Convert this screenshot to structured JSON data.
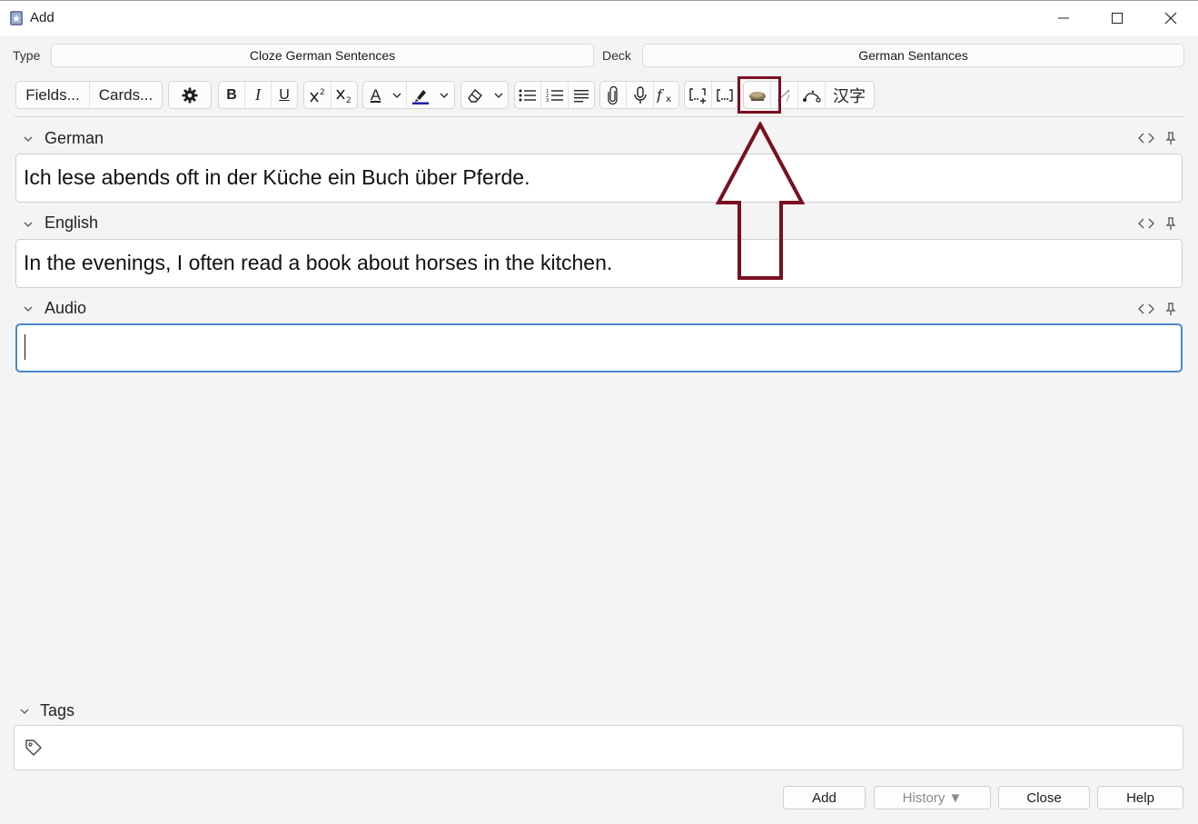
{
  "window": {
    "title": "Add"
  },
  "header": {
    "type_label": "Type",
    "type_value": "Cloze German Sentences",
    "deck_label": "Deck",
    "deck_value": "German Sentances"
  },
  "toolbar": {
    "fields_label": "Fields...",
    "cards_label": "Cards...",
    "bold_label": "B",
    "italic_label": "I",
    "underline_label": "U",
    "text_color_label": "A",
    "cjk_label": "汉字",
    "icons": [
      "gear-icon",
      "superscript-icon",
      "subscript-icon",
      "text-color-icon",
      "highlight-icon",
      "eraser-icon",
      "bullet-list-icon",
      "numbered-list-icon",
      "align-icon",
      "paperclip-icon",
      "microphone-icon",
      "formula-icon",
      "cloze-add-icon",
      "cloze-icon",
      "addon-icon",
      "edit-line-icon",
      "path-icon"
    ]
  },
  "fields": [
    {
      "name": "German",
      "value": "Ich lese abends oft in der Küche ein Buch über Pferde."
    },
    {
      "name": "English",
      "value": "In the evenings, I often read a book about horses in the kitchen."
    },
    {
      "name": "Audio",
      "value": ""
    }
  ],
  "tags": {
    "label": "Tags"
  },
  "buttons": {
    "add": "Add",
    "history": "History ▼",
    "close": "Close",
    "help": "Help"
  },
  "colors": {
    "highlight_box": "#7a0f22",
    "focus_border": "#4a86d0",
    "text_color_bar": "#000000",
    "highlight_color_bar": "#1a20a8"
  }
}
